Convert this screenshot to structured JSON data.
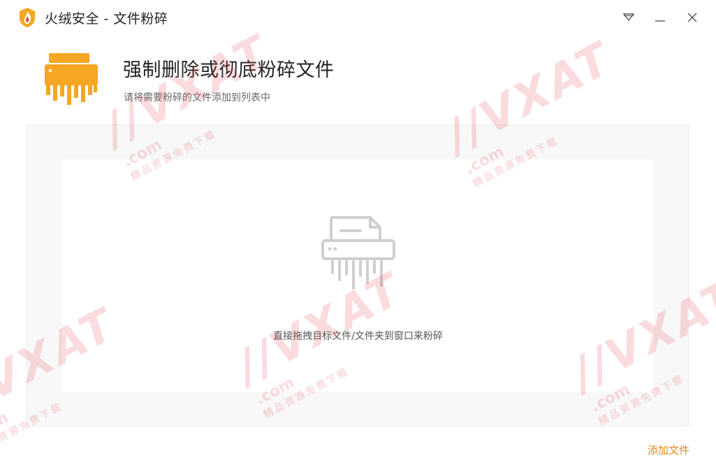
{
  "window": {
    "title": "火绒安全 - 文件粉碎",
    "menu_icon": "menu-triangle-icon",
    "minimize_icon": "minimize-icon",
    "close_icon": "close-icon"
  },
  "header": {
    "icon": "shredder-icon",
    "title": "强制删除或彻底粉碎文件",
    "subtitle": "请将需要粉碎的文件添加到列表中"
  },
  "drop_zone": {
    "icon": "shredder-outline-icon",
    "hint": "直接拖拽目标文件/文件夹到窗口来粉碎"
  },
  "footer": {
    "add_file_label": "添加文件"
  },
  "watermark": {
    "brand": "//VXAT",
    "domain": ".com",
    "slogan": "精品资源免费下载"
  },
  "colors": {
    "accent": "#f5a623",
    "accent_text": "#e08a1e",
    "watermark": "#e63c46",
    "icon_gray": "#cfcfcf"
  }
}
